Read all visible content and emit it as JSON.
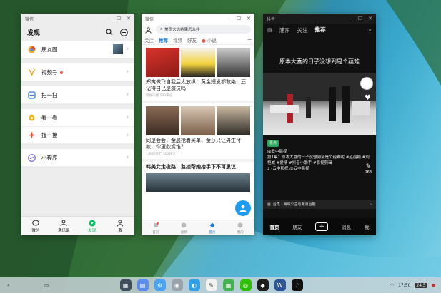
{
  "wechat": {
    "window_title": "微信",
    "header": "发现",
    "items": [
      {
        "label": "朋友圈",
        "icon": "moments-icon",
        "dot": false
      },
      {
        "label": "视频号",
        "icon": "channels-icon",
        "dot": true
      },
      {
        "label": "扫一扫",
        "icon": "scan-icon",
        "dot": false
      },
      {
        "label": "看一看",
        "icon": "look-icon",
        "dot": false
      },
      {
        "label": "搜一搜",
        "icon": "search-one-icon",
        "dot": false
      },
      {
        "label": "小程序",
        "icon": "miniprogram-icon",
        "dot": false
      }
    ],
    "tabs": [
      {
        "label": "微信",
        "icon": "chat-icon"
      },
      {
        "label": "通讯录",
        "icon": "contacts-icon"
      },
      {
        "label": "发现",
        "icon": "discover-icon"
      },
      {
        "label": "我",
        "icon": "me-icon"
      }
    ],
    "active_tab": "发现"
  },
  "news": {
    "window_title": "微信",
    "search_placeholder": "美国大选结果怎么样",
    "tabs": [
      "关注",
      "推荐",
      "视频",
      "好友",
      "小说"
    ],
    "active_tab": "推荐",
    "articles": [
      {
        "title": "郑爽做飞自我后太放纵！黄金短发都敢染，还记得自己是演员吗",
        "meta": "新娱乐圈  598评论"
      },
      {
        "title": "同是会会，金晨抢着买单，金莎只让男生付款，你更欣赏谁？",
        "meta": "七彩明星汇  103评论"
      },
      {
        "title": "韩美女走夜路，监控帮她抬手下不可思议",
        "meta": ""
      }
    ],
    "bottom_tabs": [
      "首页",
      "视频",
      "看点",
      "我的"
    ],
    "active_bottom": "看点"
  },
  "video": {
    "window_title": "抖音",
    "tabs": [
      "浦东",
      "关注",
      "推荐"
    ],
    "active_tab": "推荐",
    "caption_title": "原本大喜的日子没想到是个蕴难",
    "tag": "看点",
    "author": "@云中影视",
    "desc": "第1集：原本大喜的日子没想到会是个蕴难呢 #赵丽颖 #刘恺威 #爱情 #抖音小助手 #影视剪辑",
    "music": "♪ (云中影视 @云中影视",
    "collection": "合集 · 海峡公主与裁道台剧",
    "comment_count": "263",
    "bottom_tabs": [
      "首页",
      "朋友",
      "+",
      "消息",
      "我"
    ],
    "active_bottom": "首页"
  },
  "taskbar": {
    "time": "17:50",
    "date": "24.5"
  }
}
